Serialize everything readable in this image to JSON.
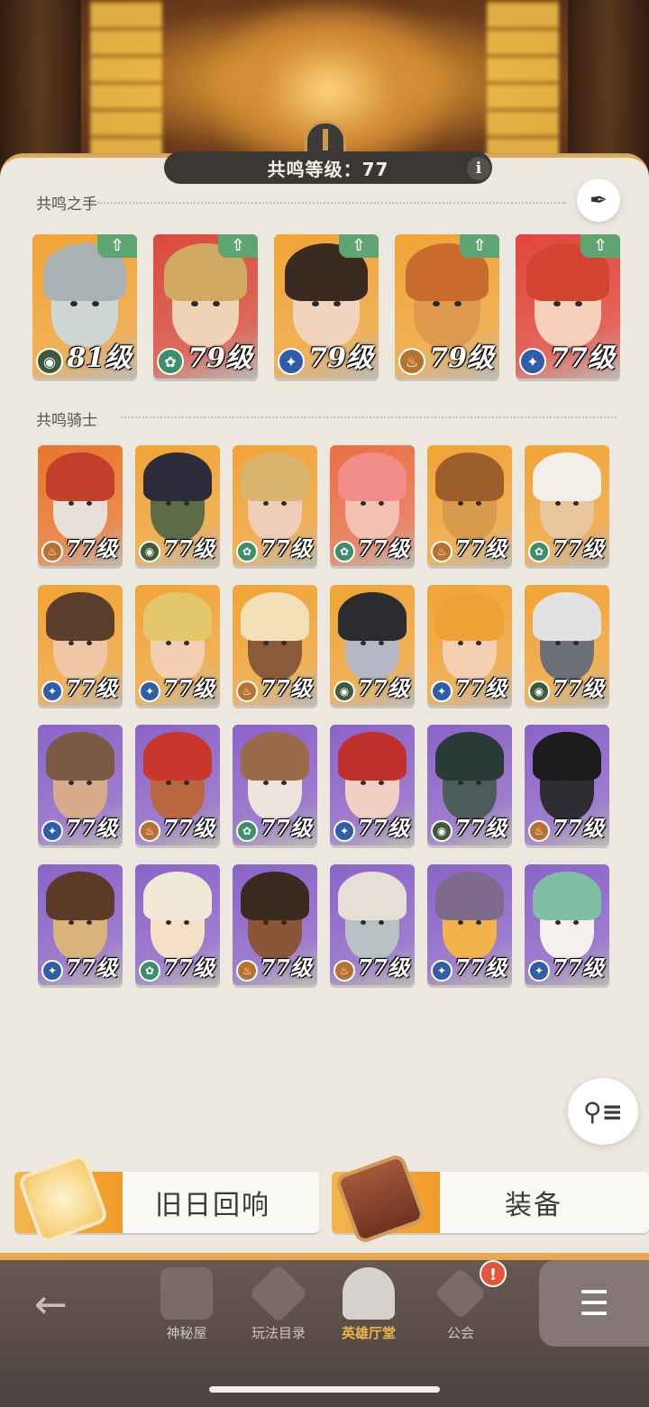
{
  "header": {
    "resonance_level_label": "共鸣等级：77",
    "info_icon": "info-icon"
  },
  "sections": {
    "hands_title": "共鸣之手",
    "knights_title": "共鸣骑士"
  },
  "hands": [
    {
      "level": "81级",
      "faction": "graveborn",
      "upgrade": true,
      "colors": [
        "#f1a436",
        "#cfd6d6",
        "#a8b2b2"
      ]
    },
    {
      "level": "79级",
      "faction": "wilder",
      "upgrade": true,
      "colors": [
        "#d94a3c",
        "#f0d2b6",
        "#d2a960"
      ]
    },
    {
      "level": "79级",
      "faction": "lightbearer",
      "upgrade": true,
      "colors": [
        "#f1a436",
        "#f2d3bd",
        "#3a2a22"
      ]
    },
    {
      "level": "79级",
      "faction": "mauler",
      "upgrade": true,
      "colors": [
        "#f1a436",
        "#e09a4f",
        "#c96b2f"
      ]
    },
    {
      "level": "77级",
      "faction": "lightbearer",
      "upgrade": true,
      "colors": [
        "#e2453b",
        "#f6d0bb",
        "#d24431"
      ]
    }
  ],
  "knights": [
    {
      "level": "77级",
      "faction": "mauler",
      "colors": [
        "#e8762c",
        "#e7e0d8",
        "#c23f2c"
      ]
    },
    {
      "level": "77级",
      "faction": "graveborn",
      "colors": [
        "#f1a436",
        "#5d6b47",
        "#2c2c3a"
      ]
    },
    {
      "level": "77级",
      "faction": "wilder",
      "colors": [
        "#f1a436",
        "#f0cdb8",
        "#d9b46f"
      ]
    },
    {
      "level": "77级",
      "faction": "wilder",
      "colors": [
        "#ea6f46",
        "#f4c1b2",
        "#f08d8a"
      ]
    },
    {
      "level": "77级",
      "faction": "mauler",
      "colors": [
        "#f1a436",
        "#d99a4e",
        "#9c5e2a"
      ]
    },
    {
      "level": "77级",
      "faction": "wilder",
      "colors": [
        "#f1a436",
        "#e9c59e",
        "#f2efe9"
      ]
    },
    {
      "level": "77级",
      "faction": "lightbearer",
      "colors": [
        "#f1a436",
        "#f0c7a6",
        "#5b3f2c"
      ]
    },
    {
      "level": "77级",
      "faction": "lightbearer",
      "colors": [
        "#f1a436",
        "#f2cfb0",
        "#e4c66a"
      ]
    },
    {
      "level": "77级",
      "faction": "mauler",
      "colors": [
        "#f1a436",
        "#8a5a3b",
        "#f1e0b8"
      ]
    },
    {
      "level": "77级",
      "faction": "graveborn",
      "colors": [
        "#f1a436",
        "#b5b8c4",
        "#2a2c30"
      ]
    },
    {
      "level": "77级",
      "faction": "lightbearer",
      "colors": [
        "#f1a436",
        "#f4cfb2",
        "#f0a136"
      ]
    },
    {
      "level": "77级",
      "faction": "graveborn",
      "colors": [
        "#f1a436",
        "#6c7076",
        "#e2e2e2"
      ]
    },
    {
      "level": "77级",
      "faction": "lightbearer",
      "colors": [
        "#8b63c9",
        "#d8ab8b",
        "#7a5a44"
      ]
    },
    {
      "level": "77级",
      "faction": "mauler",
      "colors": [
        "#8b63c9",
        "#b9673e",
        "#c9372c"
      ]
    },
    {
      "level": "77级",
      "faction": "wilder",
      "colors": [
        "#8b63c9",
        "#ece5dc",
        "#9a6b4b"
      ]
    },
    {
      "level": "77级",
      "faction": "lightbearer",
      "colors": [
        "#8b63c9",
        "#f2cfc2",
        "#c0302c"
      ]
    },
    {
      "level": "77级",
      "faction": "graveborn",
      "colors": [
        "#8b63c9",
        "#4d5b5a",
        "#2a3a36"
      ]
    },
    {
      "level": "77级",
      "faction": "mauler",
      "colors": [
        "#8b63c9",
        "#2f2d33",
        "#1c1b1e"
      ]
    },
    {
      "level": "77级",
      "faction": "lightbearer",
      "colors": [
        "#8b63c9",
        "#d9b37c",
        "#5c3a28"
      ]
    },
    {
      "level": "77级",
      "faction": "wilder",
      "colors": [
        "#8b63c9",
        "#f5dfc6",
        "#f2e8d7"
      ]
    },
    {
      "level": "77级",
      "faction": "mauler",
      "colors": [
        "#8b63c9",
        "#8a5637",
        "#3b2a20"
      ]
    },
    {
      "level": "77级",
      "faction": "mauler",
      "colors": [
        "#8b63c9",
        "#b7c2c4",
        "#e5dfd6"
      ]
    },
    {
      "level": "77级",
      "faction": "lightbearer",
      "colors": [
        "#8b63c9",
        "#f1b34a",
        "#7e6b8c"
      ]
    },
    {
      "level": "77级",
      "faction": "lightbearer",
      "colors": [
        "#8b63c9",
        "#f6f0ec",
        "#7fbfa4"
      ]
    }
  ],
  "actions": {
    "echoes_label": "旧日回响",
    "equipment_label": "装备"
  },
  "nav": {
    "back": "back-arrow-icon",
    "items": [
      {
        "label": "神秘屋",
        "active": false
      },
      {
        "label": "玩法目录",
        "active": false
      },
      {
        "label": "英雄厅堂",
        "active": true
      },
      {
        "label": "公会",
        "active": false,
        "badge": "!"
      }
    ]
  },
  "faction_glyphs": {
    "graveborn": "◉",
    "wilder": "✿",
    "lightbearer": "✦",
    "mauler": "♨"
  },
  "faction_colors": {
    "graveborn": "#3e5a3a",
    "wilder": "#3f8e6b",
    "lightbearer": "#2f5ea6",
    "mauler": "#b8722f"
  }
}
